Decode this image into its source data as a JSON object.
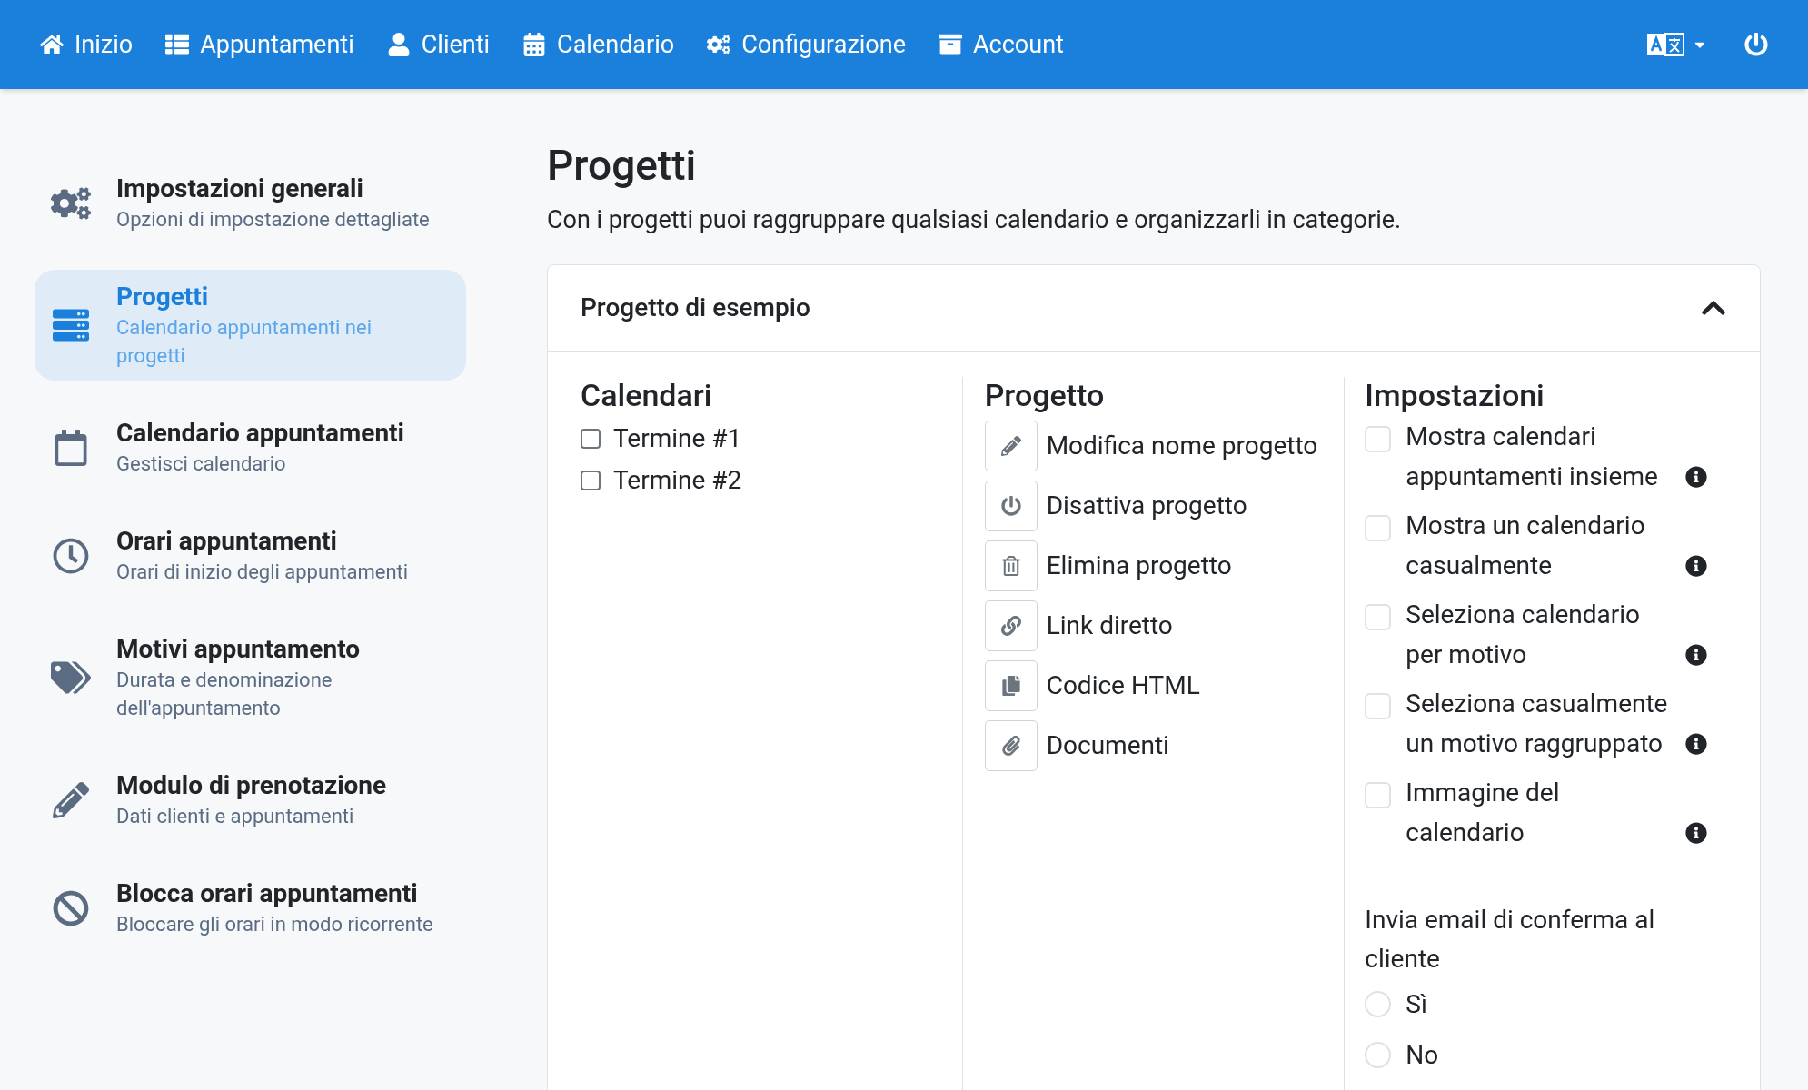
{
  "nav": {
    "items": [
      {
        "kind": "home",
        "label": "Inizio"
      },
      {
        "kind": "list",
        "label": "Appuntamenti"
      },
      {
        "kind": "user",
        "label": "Clienti"
      },
      {
        "kind": "calendar",
        "label": "Calendario"
      },
      {
        "kind": "cogs",
        "label": "Configurazione"
      },
      {
        "kind": "archive",
        "label": "Account"
      }
    ]
  },
  "sidebar": {
    "items": [
      {
        "kind": "cogs",
        "title": "Impostazioni generali",
        "subtitle": "Opzioni di impostazione dettagliate",
        "selected": false
      },
      {
        "kind": "server",
        "title": "Progetti",
        "subtitle": "Calendario appuntamenti nei progetti",
        "selected": true
      },
      {
        "kind": "calendar",
        "title": "Calendario appuntamenti",
        "subtitle": "Gestisci calendario",
        "selected": false
      },
      {
        "kind": "clock",
        "title": "Orari appuntamenti",
        "subtitle": "Orari di inizio degli appuntamenti",
        "selected": false
      },
      {
        "kind": "tags",
        "title": "Motivi appuntamento",
        "subtitle": "Durata e denominazione dell'appuntamento",
        "selected": false
      },
      {
        "kind": "pencil",
        "title": "Modulo di prenotazione",
        "subtitle": "Dati clienti e appuntamenti",
        "selected": false
      },
      {
        "kind": "ban",
        "title": "Blocca orari appuntamenti",
        "subtitle": "Bloccare gli orari in modo ricorrente",
        "selected": false
      }
    ]
  },
  "page": {
    "title": "Progetti",
    "description": "Con i progetti puoi raggruppare qualsiasi calendario e organizzarli in categorie."
  },
  "project_card": {
    "title": "Progetto di esempio",
    "expanded": true,
    "calendars": {
      "heading": "Calendari",
      "items": [
        {
          "label": "Termine #1",
          "checked": false
        },
        {
          "label": "Termine #2",
          "checked": false
        }
      ]
    },
    "project": {
      "heading": "Progetto",
      "actions": [
        {
          "kind": "edit",
          "label": "Modifica nome progetto"
        },
        {
          "kind": "power",
          "label": "Disattiva progetto"
        },
        {
          "kind": "trash",
          "label": "Elimina progetto"
        },
        {
          "kind": "link",
          "label": "Link diretto"
        },
        {
          "kind": "copy",
          "label": "Codice HTML"
        },
        {
          "kind": "paperclip",
          "label": "Documenti"
        }
      ]
    },
    "settings": {
      "heading": "Impostazioni",
      "options": [
        {
          "label": "Mostra calendari appuntamenti insieme",
          "checked": false
        },
        {
          "label": "Mostra un calendario casualmente",
          "checked": false
        },
        {
          "label": "Seleziona calendario per motivo",
          "checked": false
        },
        {
          "label": "Seleziona casualmente un motivo raggruppato",
          "checked": false
        },
        {
          "label": "Immagine del calendario",
          "checked": false
        }
      ],
      "email_confirmation": {
        "label": "Invia email di conferma al cliente",
        "options": [
          {
            "label": "Sì",
            "selected": false
          },
          {
            "label": "No",
            "selected": false
          }
        ]
      }
    }
  }
}
